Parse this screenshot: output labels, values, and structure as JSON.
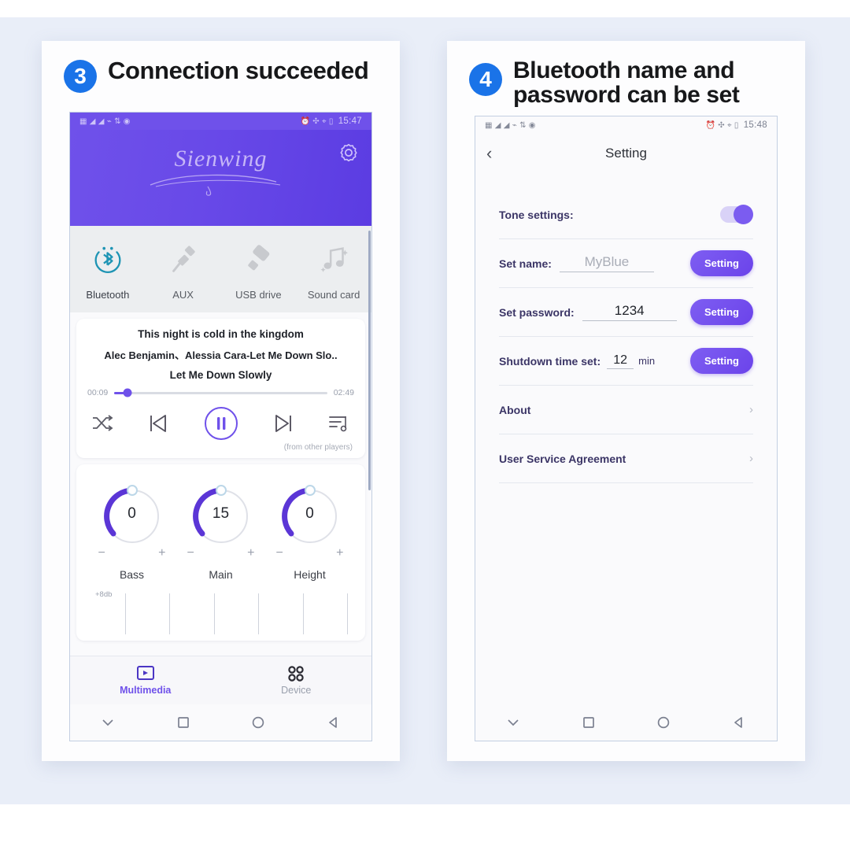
{
  "panels": [
    {
      "step": "3",
      "title": "Connection succeeded",
      "phone": {
        "statusbar": {
          "left_icons": [
            "sim-card-icon",
            "signal-1-icon",
            "signal-2-icon",
            "wifi-icon",
            "data-rate-icon",
            "alarm-circle-icon"
          ],
          "right_icons": [
            "alarm-icon",
            "bluetooth-icon",
            "location-icon",
            "battery-icon"
          ],
          "time": "15:47"
        },
        "app_header": {
          "brand": "Sienwing",
          "gear_icon": "gear-icon"
        },
        "sources": [
          {
            "icon": "bluetooth-icon",
            "label": "Bluetooth",
            "active": true
          },
          {
            "icon": "aux-plug-icon",
            "label": "AUX",
            "active": false
          },
          {
            "icon": "usb-drive-icon",
            "label": "USB drive",
            "active": false
          },
          {
            "icon": "music-notes-icon",
            "label": "Sound card",
            "active": false
          }
        ],
        "player": {
          "line1": "This night is cold in the kingdom",
          "line2": "Alec Benjamin、Alessia Cara-Let Me Down Slo..",
          "line3": "Let Me Down Slowly",
          "elapsed": "00:09",
          "duration": "02:49",
          "progress_percent": 6,
          "controls": [
            "shuffle-icon",
            "previous-icon",
            "pause-icon",
            "next-icon",
            "playlist-icon"
          ],
          "note": "(from other players)"
        },
        "knobs": [
          {
            "value": "0",
            "label": "Bass",
            "minus": "−",
            "plus": "+",
            "arc_percent": 50
          },
          {
            "value": "15",
            "label": "Main",
            "minus": "−",
            "plus": "+",
            "arc_percent": 50
          },
          {
            "value": "0",
            "label": "Height",
            "minus": "−",
            "plus": "+",
            "arc_percent": 50
          }
        ],
        "eq": {
          "label": "+8db",
          "line_count": 6
        },
        "tabs": [
          {
            "icon": "multimedia-icon",
            "label": "Multimedia",
            "active": true
          },
          {
            "icon": "device-grid-icon",
            "label": "Device",
            "active": false
          }
        ],
        "navbar": [
          "chevron-down-icon",
          "recent-apps-icon",
          "home-icon",
          "back-icon"
        ]
      }
    },
    {
      "step": "4",
      "title": "Bluetooth name and password can be set",
      "phone": {
        "statusbar": {
          "left_icons": [
            "sim-card-icon",
            "signal-1-icon",
            "signal-2-icon",
            "wifi-icon",
            "data-rate-icon",
            "alarm-circle-icon"
          ],
          "right_icons": [
            "alarm-icon",
            "bluetooth-icon",
            "location-icon",
            "battery-icon"
          ],
          "time": "15:48"
        },
        "appbar": {
          "back_icon": "back-chevron-icon",
          "title": "Setting"
        },
        "rows": [
          {
            "type": "toggle",
            "label": "Tone settings:",
            "toggle_on": true
          },
          {
            "type": "field",
            "label": "Set name:",
            "placeholder": "MyBlue",
            "value": "",
            "button": "Setting"
          },
          {
            "type": "field",
            "label": "Set password:",
            "placeholder": "",
            "value": "1234",
            "button": "Setting"
          },
          {
            "type": "field-unit",
            "label": "Shutdown time set:",
            "value": "12",
            "unit": "min",
            "button": "Setting"
          },
          {
            "type": "link",
            "label": "About",
            "chevron": "›"
          },
          {
            "type": "link",
            "label": "User Service Agreement",
            "chevron": "›"
          }
        ],
        "navbar": [
          "chevron-down-icon",
          "recent-apps-icon",
          "home-icon",
          "back-icon"
        ]
      }
    }
  ],
  "colors": {
    "page_background": "#e9eef8",
    "badge_blue": "#1a73e8",
    "header_purple_start": "#6f51ea",
    "header_purple_end": "#5b3ce2",
    "accent_purple": "#6f51ea",
    "bluetooth_teal": "#1e94b4",
    "label_indigo": "#3b3566"
  }
}
